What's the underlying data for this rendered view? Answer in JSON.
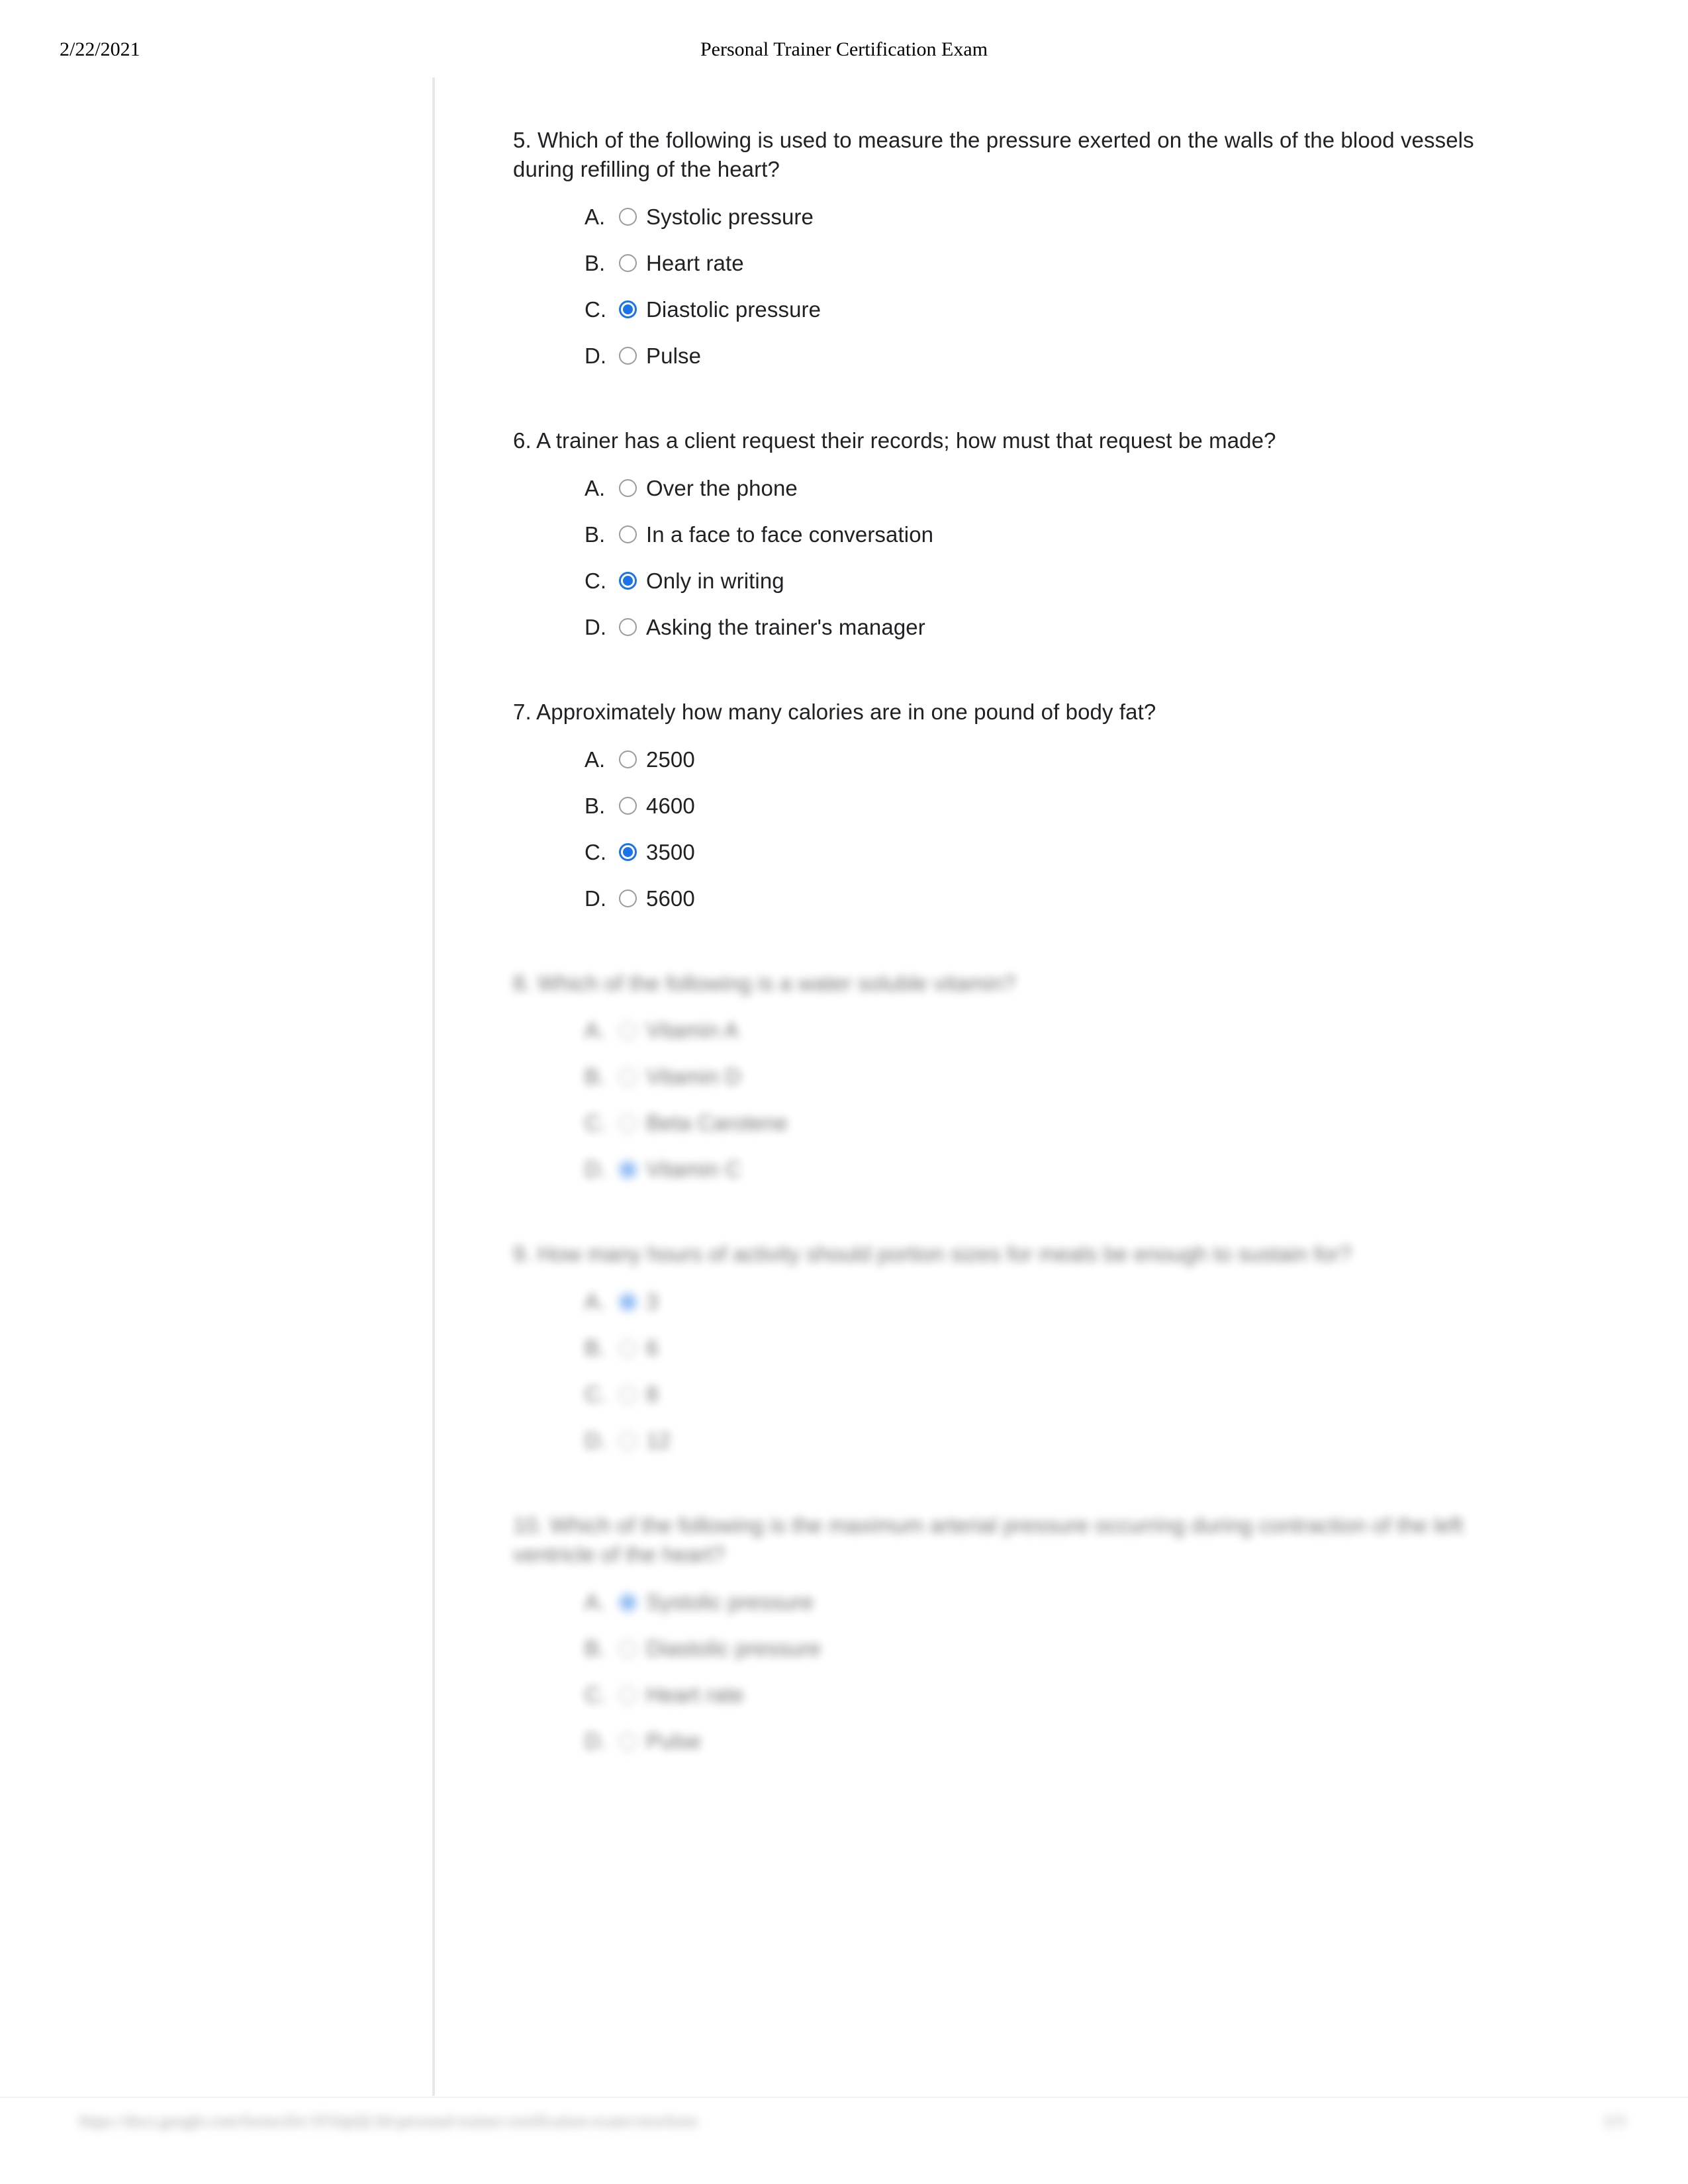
{
  "header": {
    "date": "2/22/2021",
    "title": "Personal Trainer Certification Exam"
  },
  "footer": {
    "url": "https://docs.google.com/forms/d/e/1FAIpQLSd-personal-trainer-certification-exam/viewform",
    "page": "2/3"
  },
  "questions": [
    {
      "number": "5.",
      "text": "5. Which of the following is used to measure the pressure exerted on the walls of the blood vessels during refilling of the heart?",
      "blur": "none",
      "options": [
        {
          "letter": "A.",
          "label": "Systolic pressure",
          "selected": false
        },
        {
          "letter": "B.",
          "label": "Heart rate",
          "selected": false
        },
        {
          "letter": "C.",
          "label": "Diastolic pressure",
          "selected": true
        },
        {
          "letter": "D.",
          "label": "Pulse",
          "selected": false
        }
      ]
    },
    {
      "number": "6.",
      "text": "6. A trainer has a client request their records; how must that request be made?",
      "blur": "none",
      "options": [
        {
          "letter": "A.",
          "label": "Over the phone",
          "selected": false
        },
        {
          "letter": "B.",
          "label": "In a face to face conversation",
          "selected": false
        },
        {
          "letter": "C.",
          "label": "Only in writing",
          "selected": true
        },
        {
          "letter": "D.",
          "label": "Asking the trainer's manager",
          "selected": false
        }
      ]
    },
    {
      "number": "7.",
      "text": "7. Approximately how many calories are in one pound of body fat?",
      "blur": "none",
      "options": [
        {
          "letter": "A.",
          "label": "2500",
          "selected": false
        },
        {
          "letter": "B.",
          "label": "4600",
          "selected": false
        },
        {
          "letter": "C.",
          "label": "3500",
          "selected": true
        },
        {
          "letter": "D.",
          "label": "5600",
          "selected": false
        }
      ]
    },
    {
      "number": "8.",
      "text": "8. Which of the following is a water soluble vitamin?",
      "blur": "blurred",
      "options": [
        {
          "letter": "A.",
          "label": "Vitamin A",
          "selected": false
        },
        {
          "letter": "B.",
          "label": "Vitamin D",
          "selected": false
        },
        {
          "letter": "C.",
          "label": "Beta Carotene",
          "selected": false
        },
        {
          "letter": "D.",
          "label": "Vitamin C",
          "selected": true
        }
      ]
    },
    {
      "number": "9.",
      "text": "9. How many hours of activity should portion sizes for meals be enough to sustain for?",
      "blur": "blurred",
      "options": [
        {
          "letter": "A.",
          "label": "3",
          "selected": true
        },
        {
          "letter": "B.",
          "label": "6",
          "selected": false
        },
        {
          "letter": "C.",
          "label": "8",
          "selected": false
        },
        {
          "letter": "D.",
          "label": "12",
          "selected": false
        }
      ]
    },
    {
      "number": "10.",
      "text": "10. Which of the following is the maximum arterial pressure occurring during contraction of the left ventricle of the heart?",
      "blur": "blurred",
      "options": [
        {
          "letter": "A.",
          "label": "Systolic pressure",
          "selected": true
        },
        {
          "letter": "B.",
          "label": "Diastolic pressure",
          "selected": false
        },
        {
          "letter": "C.",
          "label": "Heart rate",
          "selected": false
        },
        {
          "letter": "D.",
          "label": "Pulse",
          "selected": false
        }
      ]
    }
  ],
  "colors": {
    "selected_radio": "#1a73e8",
    "unselected_radio_border": "#9b9b9b",
    "text": "#202124",
    "rule": "#e8e8e8"
  }
}
